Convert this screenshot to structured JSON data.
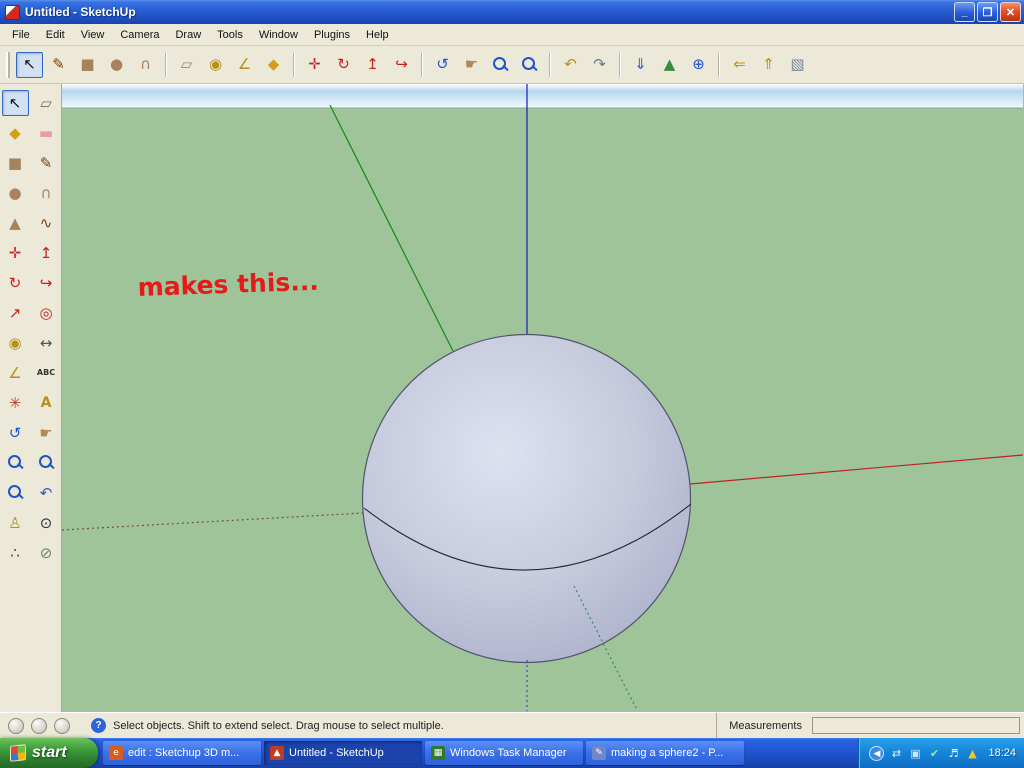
{
  "window": {
    "title": "Untitled - SketchUp",
    "minimize_glyph": "_",
    "maximize_glyph": "❐",
    "close_glyph": "✕"
  },
  "menu": {
    "items": [
      {
        "name": "menu-file",
        "label": "File"
      },
      {
        "name": "menu-edit",
        "label": "Edit"
      },
      {
        "name": "menu-view",
        "label": "View"
      },
      {
        "name": "menu-camera",
        "label": "Camera"
      },
      {
        "name": "menu-draw",
        "label": "Draw"
      },
      {
        "name": "menu-tools",
        "label": "Tools"
      },
      {
        "name": "menu-window",
        "label": "Window"
      },
      {
        "name": "menu-plugins",
        "label": "Plugins"
      },
      {
        "name": "menu-help",
        "label": "Help"
      }
    ]
  },
  "toolbar_top": {
    "items": [
      {
        "name": "select-tool",
        "glyph": "↖",
        "color": "#111111",
        "active": true
      },
      {
        "name": "line-tool",
        "glyph": "✎",
        "color": "#7a3b10"
      },
      {
        "name": "rectangle-tool",
        "glyph": "■",
        "color": "#a8825a"
      },
      {
        "name": "circle-tool",
        "glyph": "●",
        "color": "#a8825a"
      },
      {
        "name": "arc-tool",
        "glyph": "∩",
        "color": "#a8825a"
      },
      {
        "type": "sep"
      },
      {
        "name": "eraser-tool",
        "glyph": "▱",
        "color": "#8a8a7a"
      },
      {
        "name": "tape-measure-tool",
        "glyph": "◉",
        "color": "#b89018"
      },
      {
        "name": "protractor-tool",
        "glyph": "∠",
        "color": "#b89018"
      },
      {
        "name": "paint-bucket-tool",
        "glyph": "◆",
        "color": "#d4a017"
      },
      {
        "type": "sep"
      },
      {
        "name": "move-tool",
        "glyph": "✛",
        "color": "#cc2020"
      },
      {
        "name": "rotate-tool",
        "glyph": "↻",
        "color": "#cc2020"
      },
      {
        "name": "push-pull-tool",
        "glyph": "↥",
        "color": "#cc2020"
      },
      {
        "name": "follow-me-tool",
        "glyph": "↪",
        "color": "#cc2020"
      },
      {
        "type": "sep"
      },
      {
        "name": "orbit-tool",
        "glyph": "↺",
        "color": "#2255cc"
      },
      {
        "name": "pan-tool",
        "glyph": "☛",
        "color": "#b08858"
      },
      {
        "name": "zoom-tool",
        "glyph": ""
      },
      {
        "name": "zoom-extents-tool",
        "glyph": ""
      },
      {
        "type": "sep"
      },
      {
        "name": "previous-view-tool",
        "glyph": "↶",
        "color": "#b89018"
      },
      {
        "name": "next-view-tool",
        "glyph": "↷",
        "color": "#667788"
      },
      {
        "type": "sep"
      },
      {
        "name": "get-current-view-tool",
        "glyph": "⇓",
        "color": "#2255cc"
      },
      {
        "name": "toggle-terrain-tool",
        "glyph": "▲",
        "color": "#3a8a3a"
      },
      {
        "name": "google-earth-tool",
        "glyph": "⊕",
        "color": "#2255cc"
      },
      {
        "type": "sep"
      },
      {
        "name": "get-models-tool",
        "glyph": "⇐",
        "color": "#b89018"
      },
      {
        "name": "share-model-tool",
        "glyph": "⇑",
        "color": "#b89018"
      },
      {
        "name": "place-component-tool",
        "glyph": "▧",
        "color": "#778899"
      }
    ]
  },
  "toolbar_left": {
    "items": [
      {
        "name": "select-tool",
        "glyph": "↖",
        "color": "#111111",
        "active": true
      },
      {
        "name": "make-component-tool",
        "glyph": "▱",
        "color": "#7a6a4a"
      },
      {
        "name": "paint-bucket-tool",
        "glyph": "◆",
        "color": "#d4a017"
      },
      {
        "name": "eraser-tool",
        "glyph": "▬",
        "color": "#e89aa8"
      },
      {
        "name": "rectangle-tool",
        "glyph": "■",
        "color": "#a8825a"
      },
      {
        "name": "line-tool",
        "glyph": "✎",
        "color": "#7a3b10"
      },
      {
        "name": "circle-tool",
        "glyph": "●",
        "color": "#a8825a"
      },
      {
        "name": "arc-tool",
        "glyph": "∩",
        "color": "#a8825a"
      },
      {
        "name": "polygon-tool",
        "glyph": "▲",
        "color": "#a8825a"
      },
      {
        "name": "freehand-tool",
        "glyph": "∿",
        "color": "#7a3b10"
      },
      {
        "name": "move-tool",
        "glyph": "✛",
        "color": "#cc2020"
      },
      {
        "name": "push-pull-tool",
        "glyph": "↥",
        "color": "#cc2020"
      },
      {
        "name": "rotate-tool",
        "glyph": "↻",
        "color": "#cc2020"
      },
      {
        "name": "follow-me-tool",
        "glyph": "↪",
        "color": "#cc2020"
      },
      {
        "name": "scale-tool",
        "glyph": "↗",
        "color": "#cc2020"
      },
      {
        "name": "offset-tool",
        "glyph": "◎",
        "color": "#cc2020"
      },
      {
        "name": "tape-measure-tool",
        "glyph": "◉",
        "color": "#b89018"
      },
      {
        "name": "dimension-tool",
        "glyph": "↔",
        "color": "#555555"
      },
      {
        "name": "protractor-tool",
        "glyph": "∠",
        "color": "#b89018"
      },
      {
        "name": "text-tool",
        "glyph": "ABC",
        "color": "#333333"
      },
      {
        "name": "axes-tool",
        "glyph": "✳",
        "color": "#cc3322"
      },
      {
        "name": "3d-text-tool",
        "glyph": "A",
        "color": "#b8901a"
      },
      {
        "name": "orbit-tool",
        "glyph": "↺",
        "color": "#2255cc"
      },
      {
        "name": "pan-tool",
        "glyph": "☛",
        "color": "#b08858"
      },
      {
        "name": "zoom-tool",
        "glyph": ""
      },
      {
        "name": "zoom-window-tool",
        "glyph": ""
      },
      {
        "name": "zoom-extents-tool",
        "glyph": ""
      },
      {
        "name": "previous-view-tool",
        "glyph": "↶",
        "color": "#3355bb"
      },
      {
        "name": "position-camera-tool",
        "glyph": "♙",
        "color": "#b89018"
      },
      {
        "name": "look-around-tool",
        "glyph": "⊙",
        "color": "#223344"
      },
      {
        "name": "walk-tool",
        "glyph": "∴",
        "color": "#554433"
      },
      {
        "name": "section-plane-tool",
        "glyph": "⊘",
        "color": "#668866"
      }
    ]
  },
  "viewport": {
    "annotation": "makes this...",
    "colors": {
      "ground": "#9fc49a",
      "annotation": "#e31b1b",
      "axis_red": "#bb2222",
      "axis_red_neg": "#7a4a44",
      "axis_green": "#128a12",
      "axis_green_neg": "#2e8a66",
      "axis_blue": "#1b1bb4",
      "axis_blue_neg": "#4444bb",
      "sphere_outline": "#4e546c",
      "equator": "#20242e"
    }
  },
  "statusbar": {
    "icons": [
      {
        "name": "status-indicator-1",
        "glyph": ""
      },
      {
        "name": "status-indicator-2",
        "glyph": ""
      },
      {
        "name": "status-indicator-3",
        "glyph": ""
      }
    ],
    "help_glyph": "?",
    "message": "Select objects. Shift to extend select. Drag mouse to select multiple.",
    "measurements_label": "Measurements"
  },
  "taskbar": {
    "start_label": "start",
    "tasks": [
      {
        "name": "task-edit-sketchup-3d",
        "label": "edit : Sketchup 3D m...",
        "icon_bg": "#d85c20",
        "icon_glyph": "e"
      },
      {
        "name": "task-untitled-sketchup",
        "label": "Untitled - SketchUp",
        "active": true,
        "icon_bg": "#c23a28",
        "icon_glyph": "▲"
      },
      {
        "name": "task-windows-task-manager",
        "label": "Windows Task Manager",
        "icon_bg": "#2f7a2f",
        "icon_glyph": "▦"
      },
      {
        "name": "task-making-a-sphere2",
        "label": "making a sphere2 - P...",
        "icon_bg": "#6f86c8",
        "icon_glyph": "✎"
      }
    ],
    "tray_chevron": "◀",
    "tray_icons": [
      {
        "name": "network-status-icon",
        "glyph": "⇄",
        "color": "#e8f4ff"
      },
      {
        "name": "display-settings-icon",
        "glyph": "▣",
        "color": "#cfe6ff"
      },
      {
        "name": "security-center-icon",
        "glyph": "✔",
        "color": "#9fe89f"
      },
      {
        "name": "volume-icon",
        "glyph": "♬",
        "color": "#ffffff"
      },
      {
        "name": "updates-icon",
        "glyph": "▲",
        "color": "#f4c430"
      }
    ],
    "clock": "18:24"
  }
}
